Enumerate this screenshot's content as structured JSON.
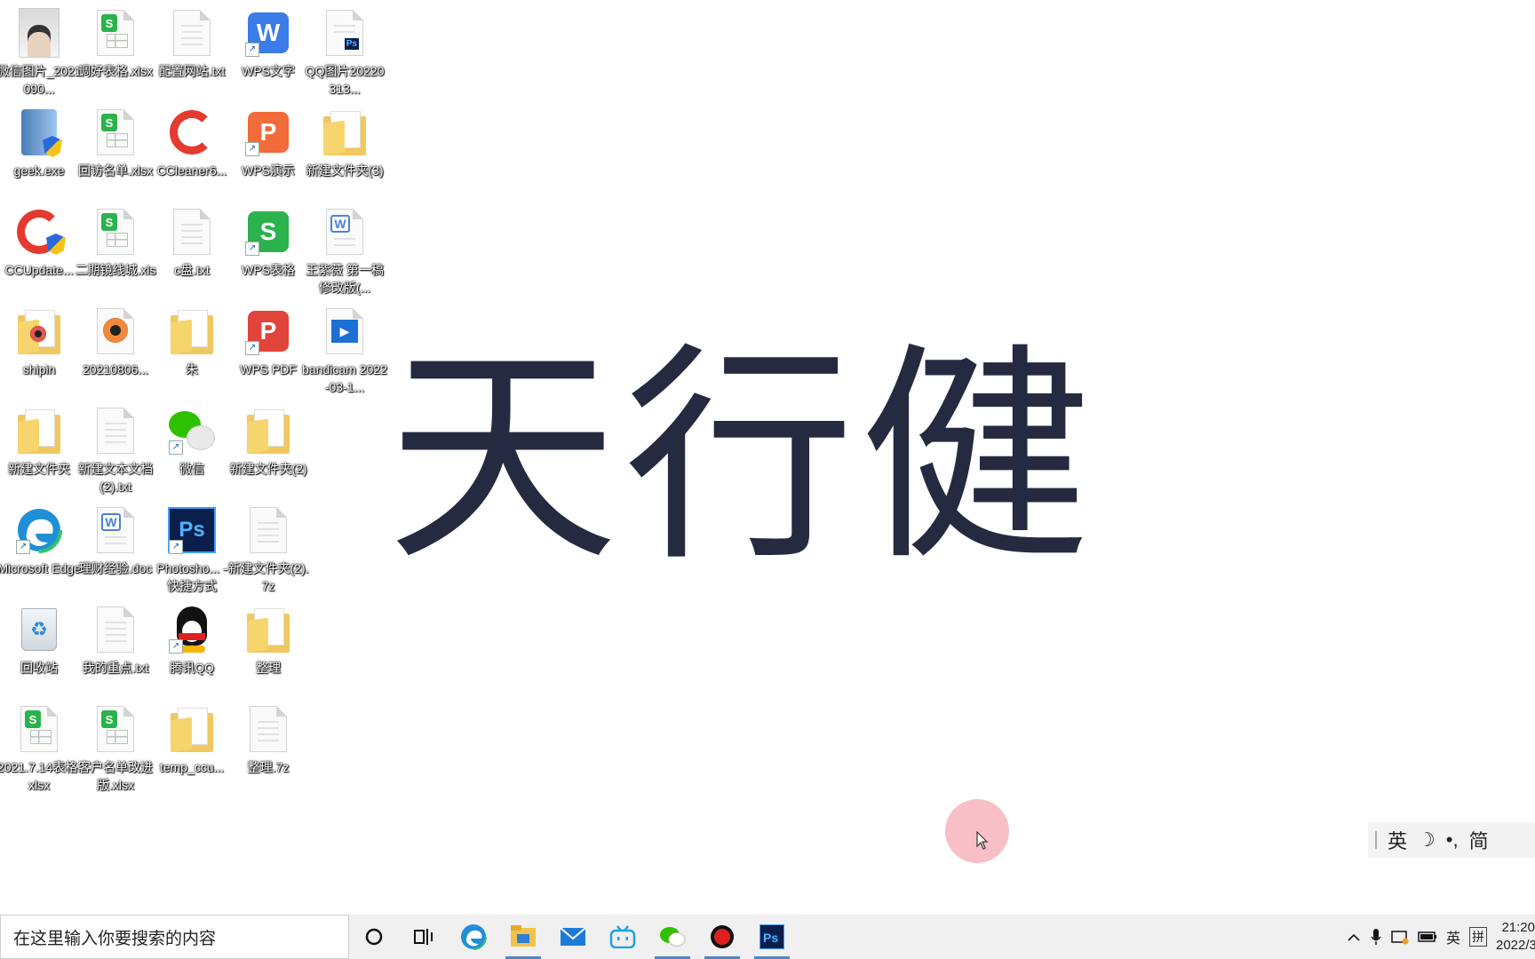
{
  "desktop": {
    "icons": [
      {
        "label": "微信图片_2021090...",
        "type": "photo"
      },
      {
        "label": "调好表格.xlsx",
        "type": "xlsx"
      },
      {
        "label": "配置网站.txt",
        "type": "txt"
      },
      {
        "label": "WPS文字",
        "type": "wps-writer"
      },
      {
        "label": "QQ图片20220313...",
        "type": "image"
      },
      {
        "label": "geek.exe",
        "type": "exe"
      },
      {
        "label": "回访名单.xlsx",
        "type": "xlsx"
      },
      {
        "label": "CCleaner6...",
        "type": "ccleaner"
      },
      {
        "label": "WPS演示",
        "type": "wps-presentation"
      },
      {
        "label": "新建文件夹(3)",
        "type": "folder"
      },
      {
        "label": "CCUpdate...",
        "type": "ccupdate"
      },
      {
        "label": "二期镜线城.xls",
        "type": "xlsx"
      },
      {
        "label": "c盘.txt",
        "type": "txt"
      },
      {
        "label": "WPS表格",
        "type": "wps-sheet"
      },
      {
        "label": "王紫薇 第一稿修改版(...",
        "type": "doc"
      },
      {
        "label": "shipin",
        "type": "folder-media"
      },
      {
        "label": "20210806...",
        "type": "media"
      },
      {
        "label": "朱",
        "type": "folder"
      },
      {
        "label": "WPS PDF",
        "type": "wps-pdf"
      },
      {
        "label": "bandicam 2022-03-1...",
        "type": "video"
      },
      {
        "label": "新建文件夹",
        "type": "folder"
      },
      {
        "label": "新建文本文档(2).txt",
        "type": "txt"
      },
      {
        "label": "微信",
        "type": "wechat"
      },
      {
        "label": "新建文件夹(2)",
        "type": "folder"
      },
      {
        "label": "Microsoft Edge",
        "type": "edge"
      },
      {
        "label": "理财经验.doc",
        "type": "doc"
      },
      {
        "label": "Photosho... - 快捷方式",
        "type": "photoshop"
      },
      {
        "label": "新建文件夹(2).7z",
        "type": "blank"
      },
      {
        "label": "回收站",
        "type": "recycle"
      },
      {
        "label": "我的重点.txt",
        "type": "txt"
      },
      {
        "label": "腾讯QQ",
        "type": "qq"
      },
      {
        "label": "整理",
        "type": "folder"
      },
      {
        "label": "2021.7.14表格.xlsx",
        "type": "xlsx"
      },
      {
        "label": "客户名单改进版.xlsx",
        "type": "xlsx"
      },
      {
        "label": "temp_ccu...",
        "type": "folder"
      },
      {
        "label": "整理.7z",
        "type": "blank"
      }
    ]
  },
  "hero_text": "天行健",
  "ime": {
    "lang": "英",
    "moon": "☽",
    "punct": "•,",
    "mode": "简"
  },
  "taskbar": {
    "search_placeholder": "在这里输入你要搜索的内容",
    "apps": [
      "cortana-icon",
      "task-view-icon",
      "edge-icon",
      "file-explorer-icon",
      "mail-icon",
      "bilibili-icon",
      "wechat-icon",
      "record-icon",
      "photoshop-icon"
    ],
    "tray": {
      "lang": "英",
      "ime": "拼",
      "time": "21:20",
      "date": "2022/3/..."
    }
  },
  "colors": {
    "hero": "#262a40",
    "taskbar": "#f0f0f0",
    "cursor_ring": "#f8bcc4"
  }
}
